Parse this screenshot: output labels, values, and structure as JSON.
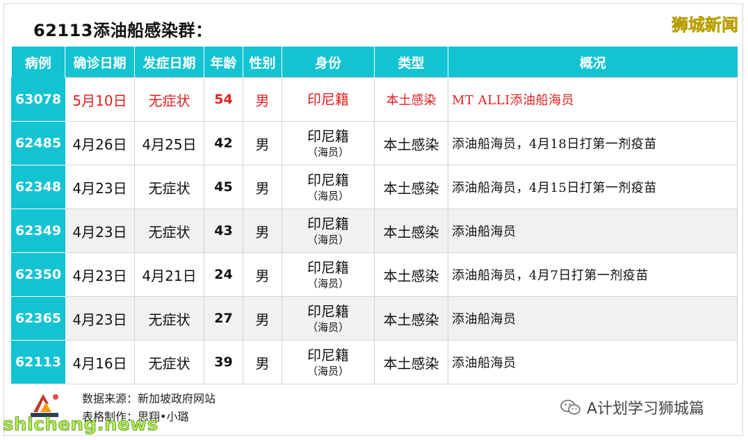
{
  "title": "62113添油船感染群：",
  "brand": "狮城新闻",
  "table": {
    "headers": [
      "病例",
      "确诊日期",
      "发症日期",
      "年龄",
      "性别",
      "身份",
      "类型",
      "概况"
    ],
    "rows": [
      {
        "id": "63078",
        "confirm": "5月10日",
        "onset": "无症状",
        "age": "54",
        "sex": "男",
        "identity": "印尼籍",
        "identity_sub": "",
        "type": "本土感染",
        "note": "MT ALLI添油船海员"
      },
      {
        "id": "62485",
        "confirm": "4月26日",
        "onset": "4月25日",
        "age": "42",
        "sex": "男",
        "identity": "印尼籍",
        "identity_sub": "（海员）",
        "type": "本土感染",
        "note": "添油船海员，4月18日打第一剂疫苗"
      },
      {
        "id": "62348",
        "confirm": "4月23日",
        "onset": "无症状",
        "age": "45",
        "sex": "男",
        "identity": "印尼籍",
        "identity_sub": "（海员）",
        "type": "本土感染",
        "note": "添油船海员，4月15日打第一剂疫苗"
      },
      {
        "id": "62349",
        "confirm": "4月23日",
        "onset": "无症状",
        "age": "43",
        "sex": "男",
        "identity": "印尼籍",
        "identity_sub": "（海员）",
        "type": "本土感染",
        "note": "添油船海员"
      },
      {
        "id": "62350",
        "confirm": "4月23日",
        "onset": "4月21日",
        "age": "24",
        "sex": "男",
        "identity": "印尼籍",
        "identity_sub": "（海员）",
        "type": "本土感染",
        "note": "添油船海员，4月7日打第一剂疫苗"
      },
      {
        "id": "62365",
        "confirm": "4月23日",
        "onset": "无症状",
        "age": "27",
        "sex": "男",
        "identity": "印尼籍",
        "identity_sub": "（海员）",
        "type": "本土感染",
        "note": "添油船海员"
      },
      {
        "id": "62113",
        "confirm": "4月16日",
        "onset": "无症状",
        "age": "39",
        "sex": "男",
        "identity": "印尼籍",
        "identity_sub": "（海员）",
        "type": "本土感染",
        "note": "添油船海员"
      }
    ]
  },
  "footer": {
    "logo_text": "学习狮城篇",
    "source": "数据来源：新加坡政府网站",
    "maker": "表格制作：思翔•小璐",
    "wechat_name": "A计划学习狮城篇",
    "watermark": "shicheng.news"
  },
  "colors": {
    "header_bg": "#12c3d2",
    "highlight_text": "#e21f1f",
    "brand_text": "#f5e21b",
    "watermark_text": "#b6ec52"
  }
}
